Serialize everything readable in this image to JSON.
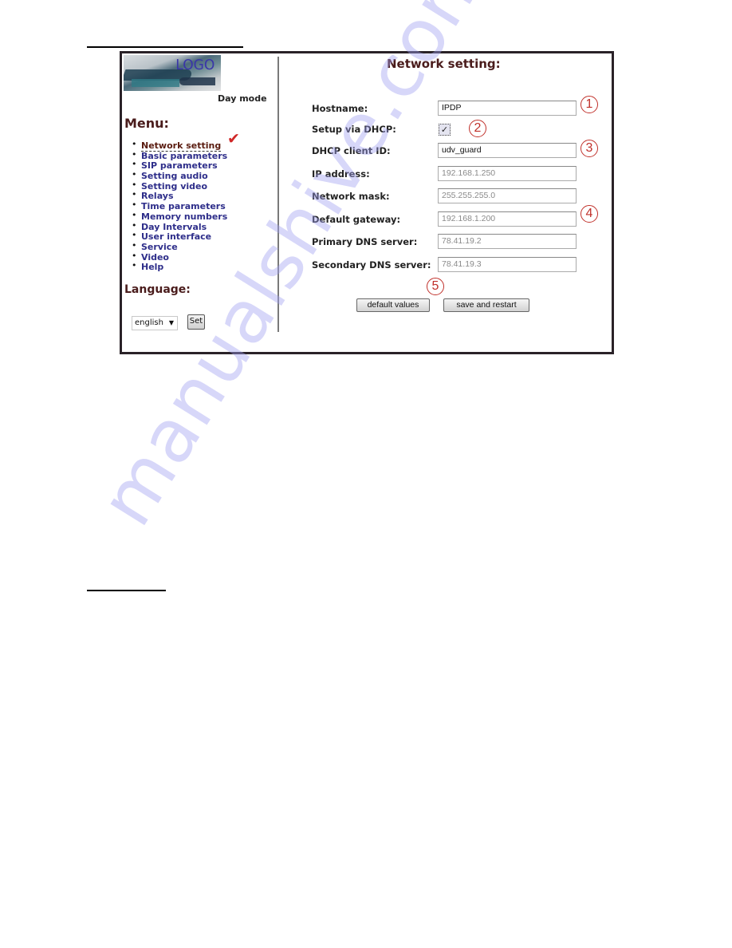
{
  "watermark": "manualshive.com",
  "logo": {
    "text": "LOGO"
  },
  "sidebar": {
    "mode": "Day mode",
    "menu_title": "Menu:",
    "items": [
      {
        "label": "Network setting",
        "active": true
      },
      {
        "label": "Basic parameters"
      },
      {
        "label": "SIP parameters"
      },
      {
        "label": "Setting audio"
      },
      {
        "label": "Setting video"
      },
      {
        "label": "Relays"
      },
      {
        "label": "Time parameters"
      },
      {
        "label": "Memory numbers"
      },
      {
        "label": "Day Intervals"
      },
      {
        "label": "User interface"
      },
      {
        "label": "Service"
      },
      {
        "label": "Video"
      },
      {
        "label": "Help"
      }
    ],
    "active_marker": "✔",
    "language_title": "Language:",
    "language_value": "english",
    "language_arrow": "▼",
    "set_label": "Set"
  },
  "main": {
    "title": "Network setting:",
    "fields": {
      "hostname": {
        "label": "Hostname:",
        "value": "IPDP"
      },
      "dhcp": {
        "label": "Setup via DHCP:",
        "checked": true,
        "mark": "✓"
      },
      "client_id": {
        "label": "DHCP client ID:",
        "value": "udv_guard"
      },
      "ip": {
        "label": "IP address:",
        "value": "192.168.1.250"
      },
      "mask": {
        "label": "Network mask:",
        "value": "255.255.255.0"
      },
      "gateway": {
        "label": "Default gateway:",
        "value": "192.168.1.200"
      },
      "dns1": {
        "label": "Primary DNS server:",
        "value": "78.41.19.2"
      },
      "dns2": {
        "label": "Secondary DNS server:",
        "value": "78.41.19.3"
      }
    },
    "badges": [
      "1",
      "2",
      "3",
      "4",
      "5"
    ],
    "buttons": {
      "defaults": "default values",
      "save": "save and restart"
    }
  },
  "colors": {
    "heading": "#4a1c1c",
    "menu_link": "#2e2e8a",
    "annotation": "#c0302a",
    "checkmark": "#d02828"
  }
}
